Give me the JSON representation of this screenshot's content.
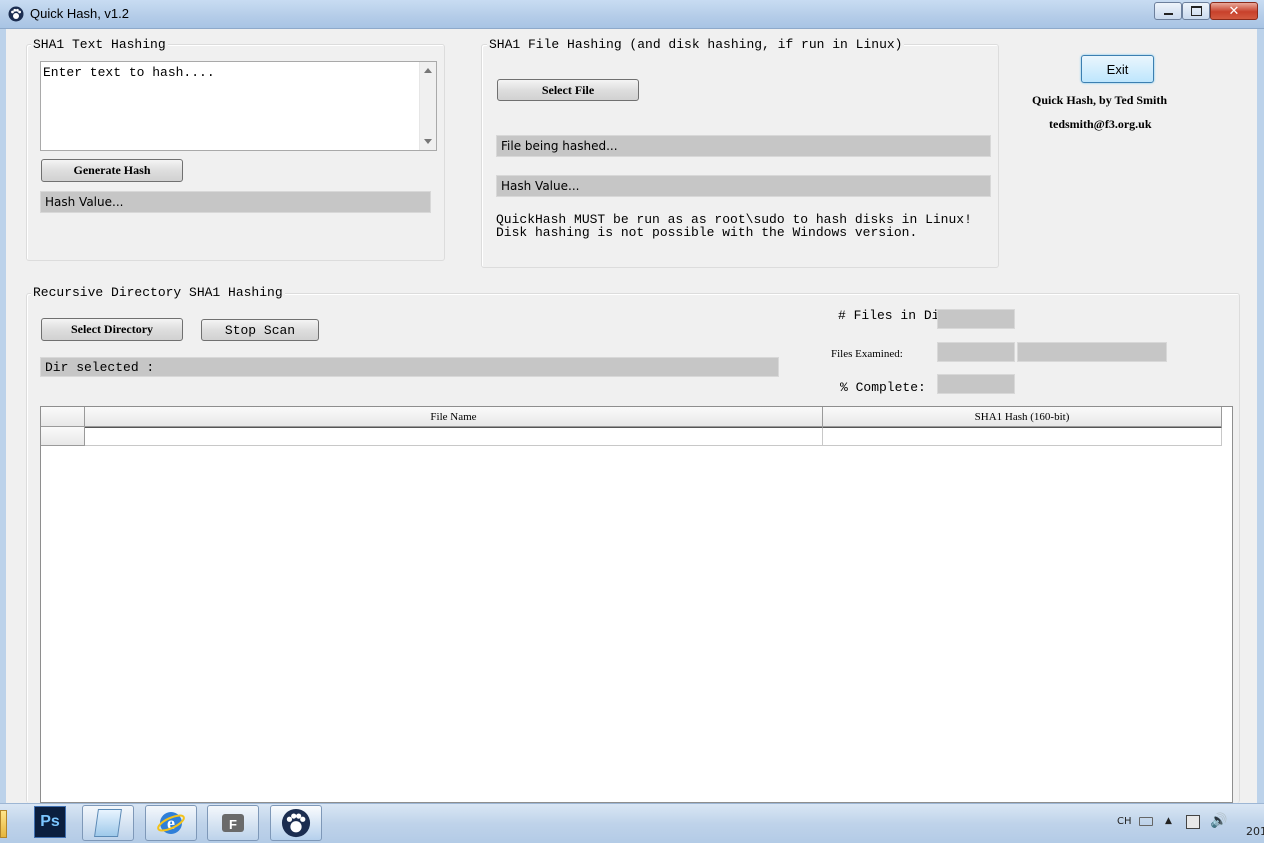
{
  "window": {
    "title": "Quick Hash, v1.2"
  },
  "text_hashing": {
    "group_label": "SHA1 Text Hashing",
    "textarea_value": "Enter text to hash....",
    "generate_label": "Generate Hash",
    "hash_value": "Hash Value..."
  },
  "file_hashing": {
    "group_label": "SHA1 File Hashing (and disk hashing, if run in Linux)",
    "select_file_label": "Select File",
    "file_being_hashed": "File being hashed...",
    "hash_value": "Hash Value...",
    "note_line1": "QuickHash MUST be run as as root\\sudo to hash disks in Linux!",
    "note_line2": "Disk hashing is not possible with the Windows version."
  },
  "side": {
    "exit_label": "Exit",
    "credit": "Quick Hash, by Ted Smith",
    "email": "tedsmith@f3.org.uk"
  },
  "dir_hashing": {
    "group_label": "Recursive Directory SHA1  Hashing",
    "select_dir_label": "Select Directory",
    "stop_scan_label": "Stop Scan",
    "dir_selected": "Dir selected :",
    "files_in_dir_label": "# Files in Dir",
    "files_examined_label": "Files Examined:",
    "percent_complete_label": "% Complete:",
    "columns": [
      "File Name",
      "SHA1 Hash (160-bit)"
    ]
  },
  "taskbar": {
    "apps": [
      "explorer-icon",
      "photoshop-icon",
      "notepad-icon",
      "internet-explorer-icon",
      "font-tool-icon",
      "quickhash-icon"
    ],
    "ps_label": "Ps",
    "lang": "CH",
    "clock_fragment": "201"
  },
  "colors": {
    "field_gray": "#c6c6c6",
    "title_bar": "#b4cce8",
    "close_red": "#c8412b"
  }
}
